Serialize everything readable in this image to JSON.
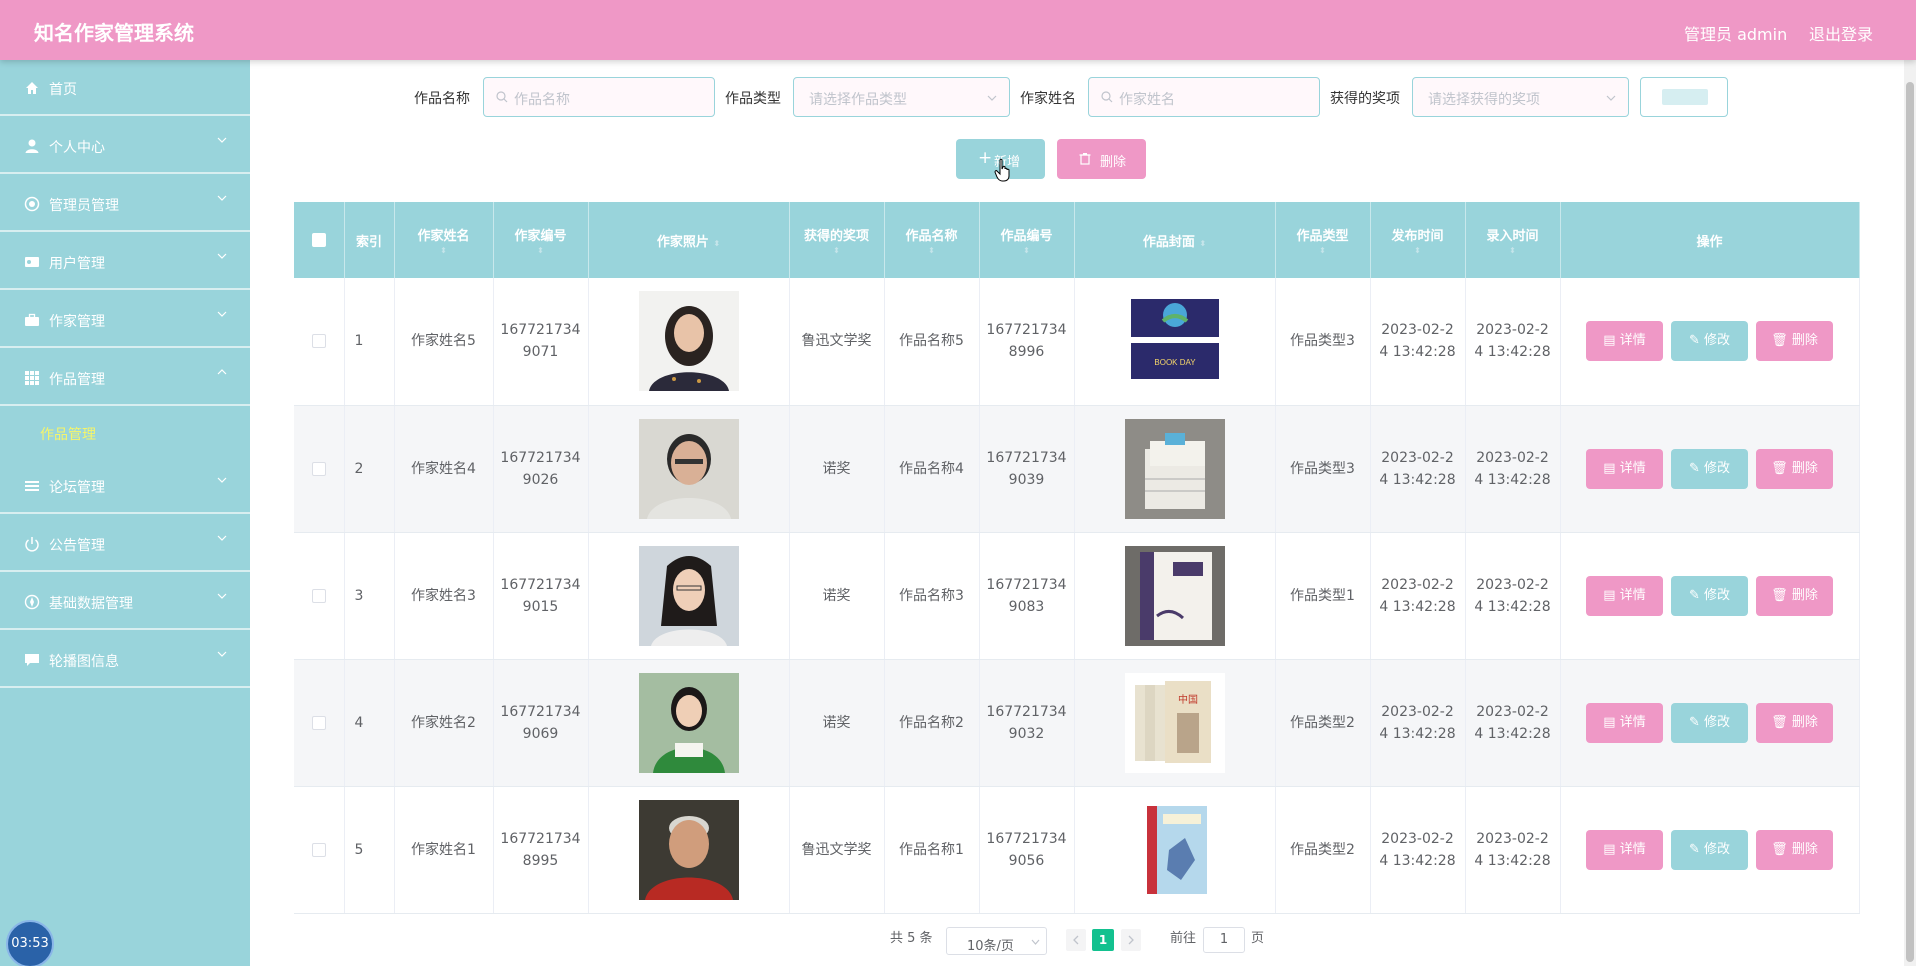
{
  "header": {
    "title": "知名作家管理系统",
    "admin": "管理员 admin",
    "logout": "退出登录"
  },
  "sidebar": {
    "items": [
      {
        "label": "首页",
        "icon": "home-icon"
      },
      {
        "label": "个人中心",
        "icon": "user-icon"
      },
      {
        "label": "管理员管理",
        "icon": "admin-icon"
      },
      {
        "label": "用户管理",
        "icon": "id-card-icon"
      },
      {
        "label": "作家管理",
        "icon": "briefcase-icon"
      },
      {
        "label": "作品管理",
        "icon": "grid-icon",
        "expanded": true
      },
      {
        "label": "论坛管理",
        "icon": "list-icon"
      },
      {
        "label": "公告管理",
        "icon": "power-icon"
      },
      {
        "label": "基础数据管理",
        "icon": "compass-icon"
      },
      {
        "label": "轮播图信息",
        "icon": "chat-icon"
      }
    ],
    "submenu_label": "作品管理"
  },
  "clock": "03:53",
  "search": {
    "work_name_label": "作品名称",
    "work_name_placeholder": "作品名称",
    "work_type_label": "作品类型",
    "work_type_placeholder": "请选择作品类型",
    "author_name_label": "作家姓名",
    "author_name_placeholder": "作家姓名",
    "award_label": "获得的奖项",
    "award_placeholder": "请选择获得的奖项"
  },
  "actions": {
    "add": "新增",
    "delete": "删除"
  },
  "table": {
    "headers": [
      "索引",
      "作家姓名",
      "作家编号",
      "作家照片",
      "获得的奖项",
      "作品名称",
      "作品编号",
      "作品封面",
      "作品类型",
      "发布时间",
      "录入时间",
      "操作"
    ],
    "rows": [
      {
        "index": "1",
        "author": "作家姓名5",
        "author_no_1": "167721734",
        "author_no_2": "9071",
        "award": "鲁迅文学奖",
        "work": "作品名称5",
        "work_no_1": "167721734",
        "work_no_2": "8996",
        "type": "作品类型3",
        "pub_1": "2023-02-2",
        "pub_2": "4 13:42:28",
        "rec_1": "2023-02-2",
        "rec_2": "4 13:42:28"
      },
      {
        "index": "2",
        "author": "作家姓名4",
        "author_no_1": "167721734",
        "author_no_2": "9026",
        "award": "诺奖",
        "work": "作品名称4",
        "work_no_1": "167721734",
        "work_no_2": "9039",
        "type": "作品类型3",
        "pub_1": "2023-02-2",
        "pub_2": "4 13:42:28",
        "rec_1": "2023-02-2",
        "rec_2": "4 13:42:28"
      },
      {
        "index": "3",
        "author": "作家姓名3",
        "author_no_1": "167721734",
        "author_no_2": "9015",
        "award": "诺奖",
        "work": "作品名称3",
        "work_no_1": "167721734",
        "work_no_2": "9083",
        "type": "作品类型1",
        "pub_1": "2023-02-2",
        "pub_2": "4 13:42:28",
        "rec_1": "2023-02-2",
        "rec_2": "4 13:42:28"
      },
      {
        "index": "4",
        "author": "作家姓名2",
        "author_no_1": "167721734",
        "author_no_2": "9069",
        "award": "诺奖",
        "work": "作品名称2",
        "work_no_1": "167721734",
        "work_no_2": "9032",
        "type": "作品类型2",
        "pub_1": "2023-02-2",
        "pub_2": "4 13:42:28",
        "rec_1": "2023-02-2",
        "rec_2": "4 13:42:28"
      },
      {
        "index": "5",
        "author": "作家姓名1",
        "author_no_1": "167721734",
        "author_no_2": "8995",
        "award": "鲁迅文学奖",
        "work": "作品名称1",
        "work_no_1": "167721734",
        "work_no_2": "9056",
        "type": "作品类型2",
        "pub_1": "2023-02-2",
        "pub_2": "4 13:42:28",
        "rec_1": "2023-02-2",
        "rec_2": "4 13:42:28"
      }
    ],
    "op_detail": "详情",
    "op_edit": "修改",
    "op_delete": "删除"
  },
  "pagination": {
    "total": "共 5 条",
    "page_size": "10条/页",
    "current": "1",
    "goto": "前往",
    "page_unit": "页",
    "jump_value": "1"
  }
}
